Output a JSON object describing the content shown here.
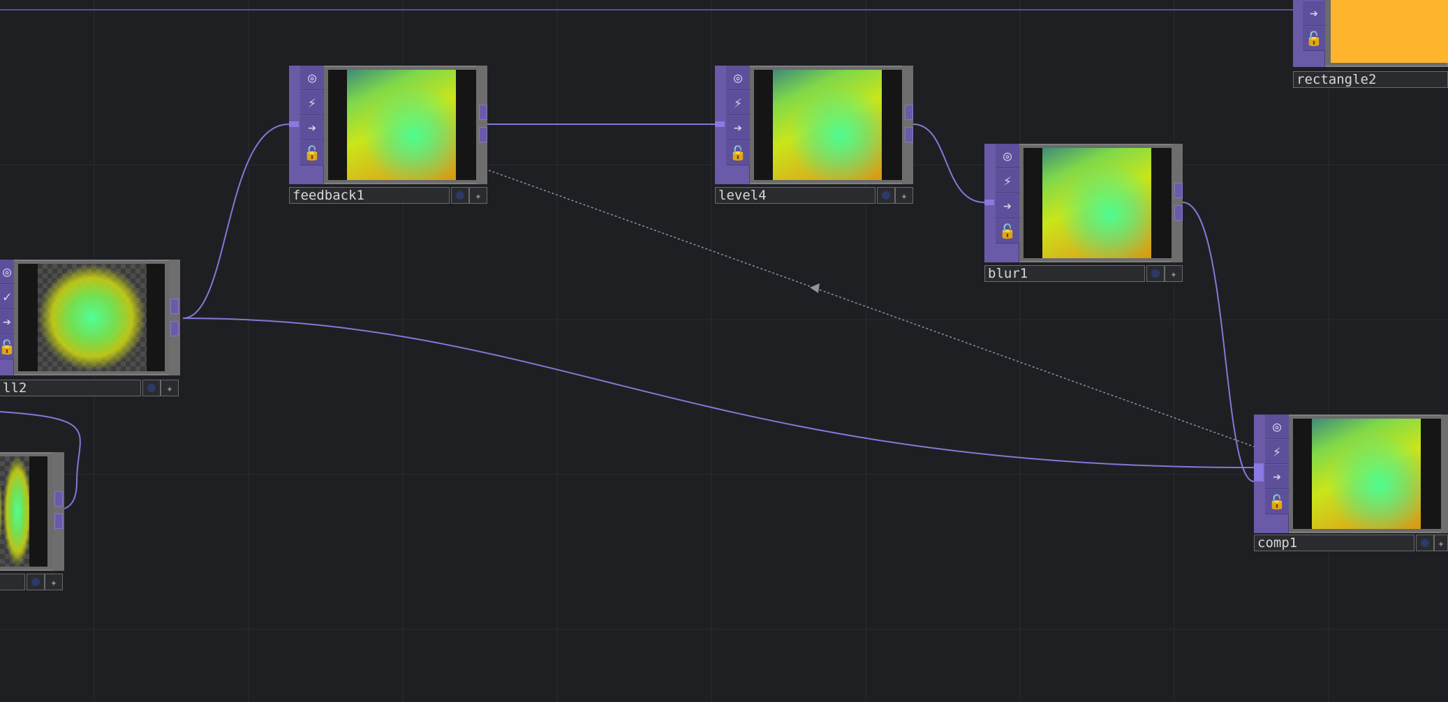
{
  "network": {
    "colors": {
      "background": "#1e1f23",
      "grid": "#2a2c31",
      "operator_strip": "#6a5aa8",
      "wire": "#8478d8",
      "reference_wire": "#8e949c",
      "rectangle_fill": "#ffb42e"
    },
    "node_buttons": {
      "viewer": "viewer-icon",
      "cook": "cook-activity-icon",
      "bypass": "pass-through-arrow-icon",
      "lock": "lock-icon"
    },
    "nodes": {
      "feedback1": {
        "name": "feedback1"
      },
      "level4": {
        "name": "level4"
      },
      "blur1": {
        "name": "blur1"
      },
      "comp1": {
        "name": "comp1"
      },
      "rectangle2": {
        "name": "rectangle2"
      },
      "left_node": {
        "name": "ll2"
      },
      "lower_left_node": {
        "name": ""
      }
    }
  }
}
